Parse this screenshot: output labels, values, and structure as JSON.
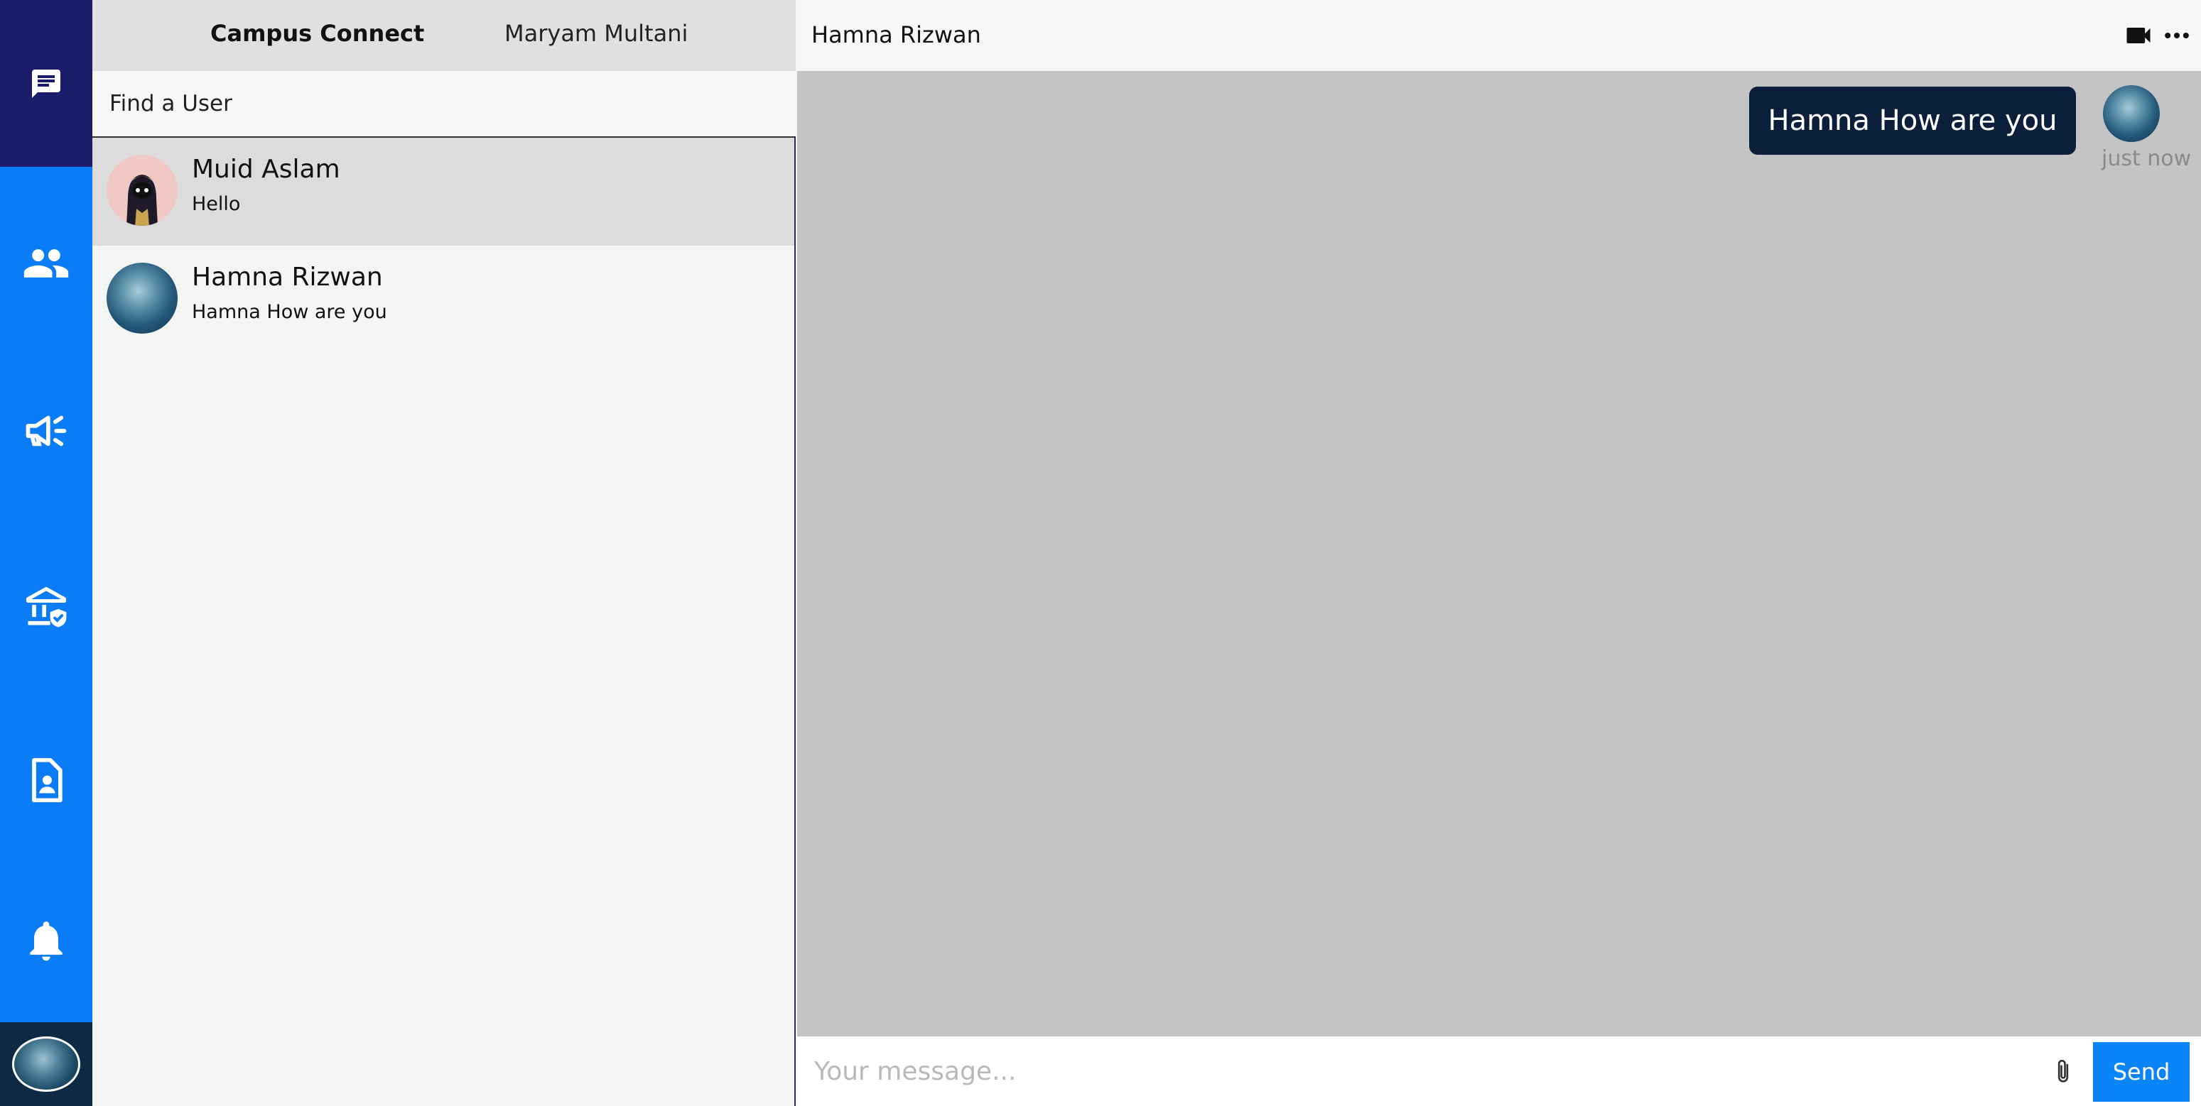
{
  "brand": "Campus Connect",
  "current_user": "Maryam Multani",
  "sidebar": {
    "items": [
      {
        "icon": "chat-icon"
      },
      {
        "icon": "users-icon"
      },
      {
        "icon": "megaphone-icon"
      },
      {
        "icon": "institution-icon"
      },
      {
        "icon": "profile-document-icon"
      },
      {
        "icon": "bell-icon"
      }
    ]
  },
  "search": {
    "placeholder": "Find a User"
  },
  "chats": [
    {
      "name": "Muid Aslam",
      "last_message": "Hello",
      "active": true
    },
    {
      "name": "Hamna Rizwan",
      "last_message": "Hamna How are you",
      "active": false
    }
  ],
  "chat": {
    "title": "Hamna Rizwan",
    "messages": [
      {
        "text": "Hamna How are you",
        "time": "just now",
        "own": true
      }
    ]
  },
  "composer": {
    "placeholder": "Your message...",
    "send_label": "Send"
  },
  "colors": {
    "rail_blue": "#0a7cf7",
    "rail_top": "#1a1c6b",
    "bubble": "#0c1f3a",
    "send": "#0a84f7"
  }
}
